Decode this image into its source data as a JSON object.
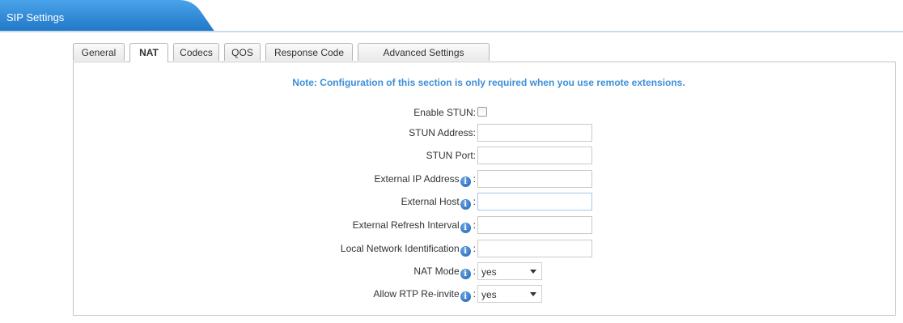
{
  "header": {
    "title": "SIP Settings"
  },
  "tabs": [
    {
      "label": "General",
      "active": false
    },
    {
      "label": "NAT",
      "active": true
    },
    {
      "label": "Codecs",
      "active": false
    },
    {
      "label": "QOS",
      "active": false
    },
    {
      "label": "Response Code",
      "active": false
    },
    {
      "label": "Advanced Settings",
      "active": false
    }
  ],
  "note": "Note: Configuration of this section is only required when you use remote extensions.",
  "form": {
    "enable_stun": {
      "label": "Enable STUN:",
      "checked": false
    },
    "stun_address": {
      "label": "STUN Address:",
      "value": ""
    },
    "stun_port": {
      "label": "STUN Port:",
      "value": ""
    },
    "external_ip": {
      "label": "External IP Address",
      "value": ""
    },
    "external_host": {
      "label": "External Host",
      "value": ""
    },
    "external_refresh": {
      "label": "External Refresh Interval",
      "value": ""
    },
    "local_network": {
      "label": "Local Network Identification",
      "value": ""
    },
    "nat_mode": {
      "label": "NAT Mode",
      "value": "yes"
    },
    "allow_rtp_reinvite": {
      "label": "Allow RTP Re-invite",
      "value": "yes"
    }
  },
  "colors": {
    "header_blue": "#2e8ad8",
    "note_blue": "#3d8fd6",
    "info_icon_blue": "#1f5fae"
  },
  "icons": {
    "info": "info-icon",
    "dropdown": "chevron-down-icon"
  },
  "glyphs": {
    "info": "i",
    "colon": ":"
  }
}
